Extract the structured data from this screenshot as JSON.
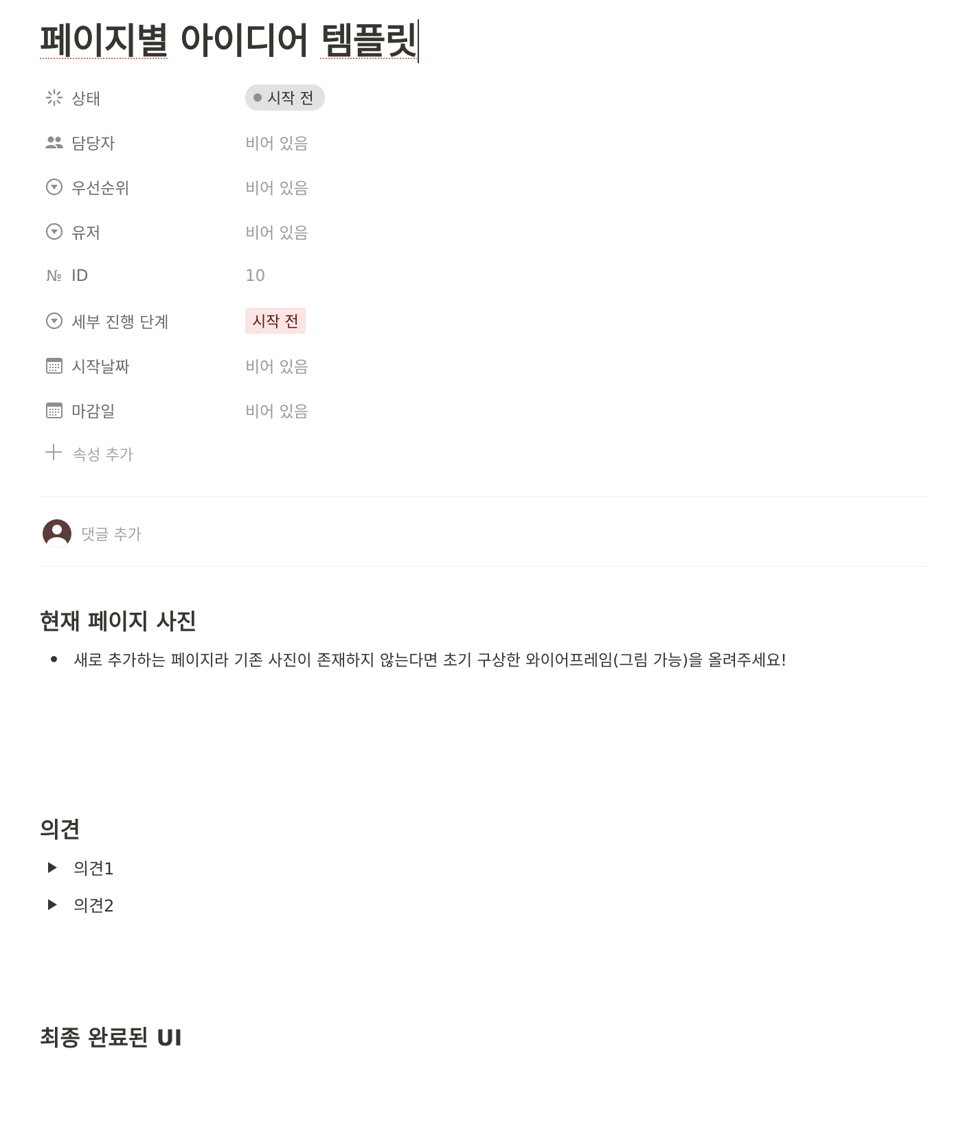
{
  "page": {
    "title_part1": "페이지별",
    "title_part2": " 아이디어 ",
    "title_part3": "템플릿"
  },
  "properties": [
    {
      "label": "상태",
      "icon": "status-spinner-icon",
      "value": "시작 전",
      "value_type": "status"
    },
    {
      "label": "담당자",
      "icon": "people-icon",
      "value": "비어 있음",
      "value_type": "empty"
    },
    {
      "label": "우선순위",
      "icon": "select-icon",
      "value": "비어 있음",
      "value_type": "empty"
    },
    {
      "label": "유저",
      "icon": "select-icon",
      "value": "비어 있음",
      "value_type": "empty"
    },
    {
      "label": "ID",
      "icon": "number-sign-icon",
      "icon_text": "№",
      "value": "10",
      "value_type": "number"
    },
    {
      "label": "세부 진행 단계",
      "icon": "select-icon",
      "value": "시작 전",
      "value_type": "tag"
    },
    {
      "label": "시작날짜",
      "icon": "calendar-icon",
      "value": "비어 있음",
      "value_type": "empty"
    },
    {
      "label": "마감일",
      "icon": "calendar-icon",
      "value": "비어 있음",
      "value_type": "empty"
    }
  ],
  "add_property": {
    "label": "속성 추가"
  },
  "comment": {
    "placeholder": "댓글 추가"
  },
  "sections": {
    "photo": {
      "heading": "현재 페이지 사진",
      "bullet": "새로 추가하는 페이지라 기존 사진이 존재하지 않는다면 초기 구상한 와이어프레임(그림 가능)을 올려주세요!"
    },
    "opinions": {
      "heading": "의견",
      "items": [
        "의견1",
        "의견2"
      ]
    },
    "final_ui": {
      "heading": "최종 완료된 UI"
    }
  },
  "colors": {
    "text": "#37352f",
    "muted": "#9b9a97",
    "status_pill_bg": "#e3e2e0",
    "tag_pink_bg": "#fbe4e4",
    "tag_pink_text": "#5d1715",
    "divider": "#ededec",
    "avatar": "#5a3d3a"
  }
}
